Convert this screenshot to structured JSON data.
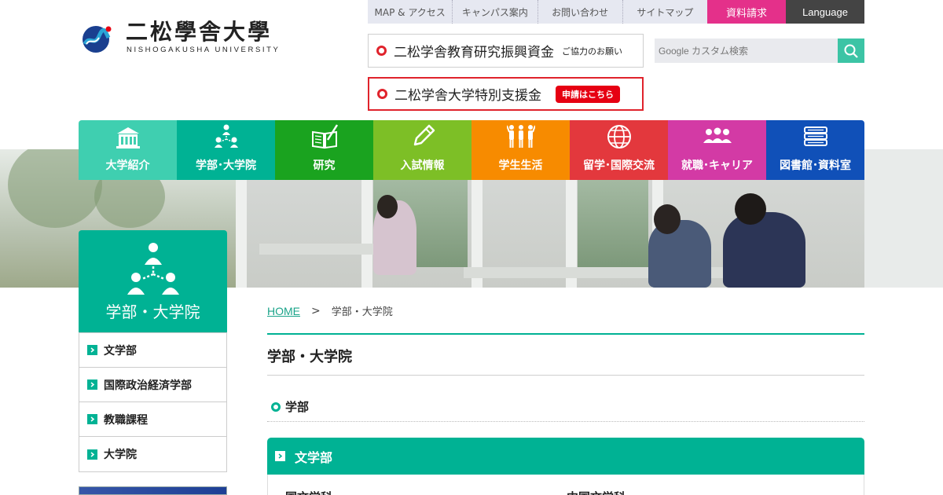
{
  "header": {
    "logo_title": "二松學舎大學",
    "logo_sub": "NISHOGAKUSHA UNIVERSITY",
    "logo_arc": "NISHOGAKUSHA",
    "util_nav": [
      "MAP & アクセス",
      "キャンパス案内",
      "お問い合わせ",
      "サイトマップ"
    ],
    "request_button": "資料請求",
    "language_button": "Language",
    "banner1": {
      "main": "二松学舎教育研究振興資金",
      "sub": "ご協力のお願い"
    },
    "banner2": {
      "main": "二松学舎大学特別支援金",
      "button": "申請はこちら"
    },
    "search": {
      "placeholder": "Google カスタム検索",
      "value": ""
    }
  },
  "main_nav": [
    {
      "label": "大学紹介",
      "icon": "building-icon",
      "color": "#3fcfb0"
    },
    {
      "label": "学部･大学院",
      "icon": "organization-icon",
      "color": "#00b294"
    },
    {
      "label": "研究",
      "icon": "book-pen-icon",
      "color": "#1aa31f"
    },
    {
      "label": "入試情報",
      "icon": "pencil-icon",
      "color": "#7dbf26"
    },
    {
      "label": "学生生活",
      "icon": "students-icon",
      "color": "#f78b00"
    },
    {
      "label": "留学･国際交流",
      "icon": "globe-icon",
      "color": "#e3383d"
    },
    {
      "label": "就職･キャリア",
      "icon": "people-icon",
      "color": "#d33aa5"
    },
    {
      "label": "図書館･資料室",
      "icon": "books-icon",
      "color": "#1050b8"
    }
  ],
  "sidebar": {
    "title": "学部・大学院",
    "items": [
      {
        "label": "文学部"
      },
      {
        "label": "国際政治経済学部"
      },
      {
        "label": "教職課程"
      },
      {
        "label": "大学院"
      }
    ]
  },
  "breadcrumb": {
    "home": "HOME",
    "separator": ">",
    "current": "学部・大学院"
  },
  "content": {
    "page_title": "学部・大学院",
    "section_title": "学部",
    "card_title": "文学部",
    "card_columns": [
      "国文学科",
      "中国文学科"
    ]
  },
  "colors": {
    "accent": "#00b294",
    "request": "#e4308a",
    "banner_red": "#e0232c"
  }
}
